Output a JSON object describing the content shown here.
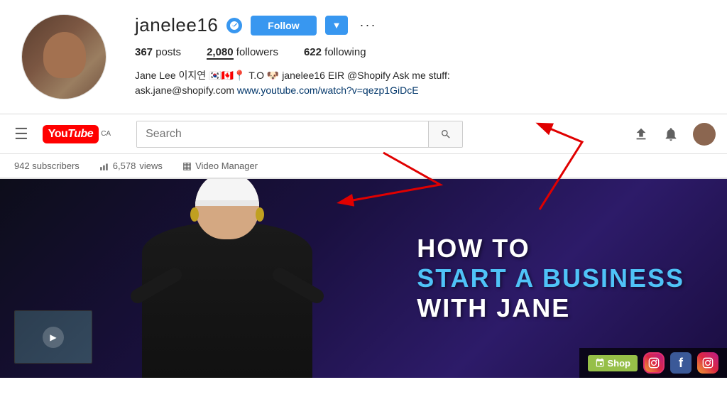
{
  "instagram": {
    "username": "janelee16",
    "verified": true,
    "follow_label": "Follow",
    "dropdown_label": "▼",
    "more_label": "···",
    "stats": {
      "posts_count": "367",
      "posts_label": "posts",
      "followers_count": "2,080",
      "followers_label": "followers",
      "following_count": "622",
      "following_label": "following"
    },
    "bio_text": "Jane Lee 이지연 🇰🇷🇨🇦📍 T.O 🐶 janelee16 EIR @Shopify Ask me stuff:",
    "bio_email": "ask.jane@shopify.com",
    "bio_link_text": "www.youtube.com/watch?v=qezp1GiDcE",
    "bio_link_href": "www.youtube.com/watch?v=qezp1GiDcE"
  },
  "youtube": {
    "logo_text": "You",
    "logo_tube": "Tube",
    "logo_ca": "CA",
    "search_placeholder": "Search",
    "subscribers": "942 subscribers",
    "views_count": "6,578",
    "views_label": "views",
    "video_manager_label": "Video Manager",
    "banner": {
      "line1": "HOW TO",
      "line2_start": "START A ",
      "line2_highlight": "BUSINESS",
      "line3": "WITH JANE"
    },
    "shop_label": "Shop",
    "social_icons": [
      "ig",
      "fb",
      "ig2"
    ]
  },
  "arrows": {
    "arrow1_note": "bio link arrow pointing right toward youtube url",
    "arrow2_note": "youtube url pointing up to ig bio"
  }
}
